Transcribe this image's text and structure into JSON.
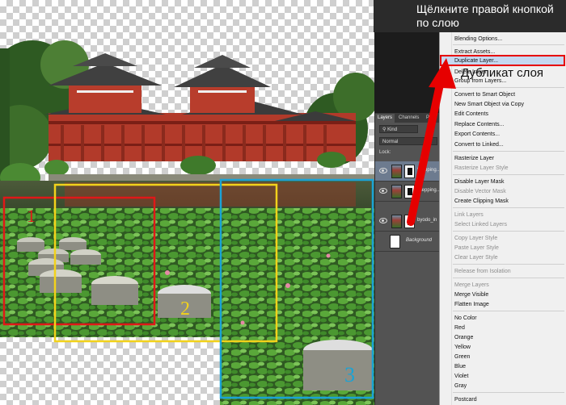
{
  "annotation": {
    "instruction_lines": [
      "Щёлкните правой кнопкой",
      "по слою"
    ],
    "label_duplicate": "Дубликат слоя",
    "arrow_color": "#e60000"
  },
  "canvas": {
    "regions": [
      {
        "label": "1",
        "color": "#e01818"
      },
      {
        "label": "2",
        "color": "#f2d21b"
      },
      {
        "label": "3",
        "color": "#1aa3d6"
      }
    ]
  },
  "layers_panel": {
    "tabs": [
      "Layers",
      "Channels",
      "Pa"
    ],
    "filter_label": "Kind",
    "blend_mode": "Normal",
    "lock_label": "Lock:",
    "layers": [
      {
        "name": "Stepping…",
        "selected": true
      },
      {
        "name": "Stepping…",
        "selected": false
      },
      {
        "name": "byodo_in",
        "selected": false
      },
      {
        "name": "Background",
        "selected": false
      }
    ]
  },
  "context_menu": {
    "items": [
      {
        "label": "Blending Options...",
        "enabled": true
      },
      {
        "label": "Extract Assets...",
        "enabled": true
      },
      {
        "label": "Duplicate Layer...",
        "enabled": true,
        "highlighted": true
      },
      {
        "label": "Delete Layer",
        "enabled": true
      },
      {
        "label": "Group from Layers...",
        "enabled": true
      },
      {
        "label": "Convert to Smart Object",
        "enabled": true
      },
      {
        "label": "New Smart Object via Copy",
        "enabled": true
      },
      {
        "label": "Edit Contents",
        "enabled": true
      },
      {
        "label": "Replace Contents...",
        "enabled": true
      },
      {
        "label": "Export Contents...",
        "enabled": true
      },
      {
        "label": "Convert to Linked...",
        "enabled": true
      },
      {
        "label": "Rasterize Layer",
        "enabled": true
      },
      {
        "label": "Rasterize Layer Style",
        "enabled": false
      },
      {
        "label": "Disable Layer Mask",
        "enabled": true
      },
      {
        "label": "Disable Vector Mask",
        "enabled": false
      },
      {
        "label": "Create Clipping Mask",
        "enabled": true
      },
      {
        "label": "Link Layers",
        "enabled": false
      },
      {
        "label": "Select Linked Layers",
        "enabled": false
      },
      {
        "label": "Copy Layer Style",
        "enabled": false
      },
      {
        "label": "Paste Layer Style",
        "enabled": false
      },
      {
        "label": "Clear Layer Style",
        "enabled": false
      },
      {
        "label": "Release from Isolation",
        "enabled": false
      },
      {
        "label": "Merge Layers",
        "enabled": false
      },
      {
        "label": "Merge Visible",
        "enabled": true
      },
      {
        "label": "Flatten Image",
        "enabled": true
      },
      {
        "label": "No Color",
        "enabled": true
      },
      {
        "label": "Red",
        "enabled": true
      },
      {
        "label": "Orange",
        "enabled": true
      },
      {
        "label": "Yellow",
        "enabled": true
      },
      {
        "label": "Green",
        "enabled": true
      },
      {
        "label": "Blue",
        "enabled": true
      },
      {
        "label": "Violet",
        "enabled": true
      },
      {
        "label": "Gray",
        "enabled": true
      },
      {
        "label": "Postcard",
        "enabled": true
      }
    ]
  }
}
